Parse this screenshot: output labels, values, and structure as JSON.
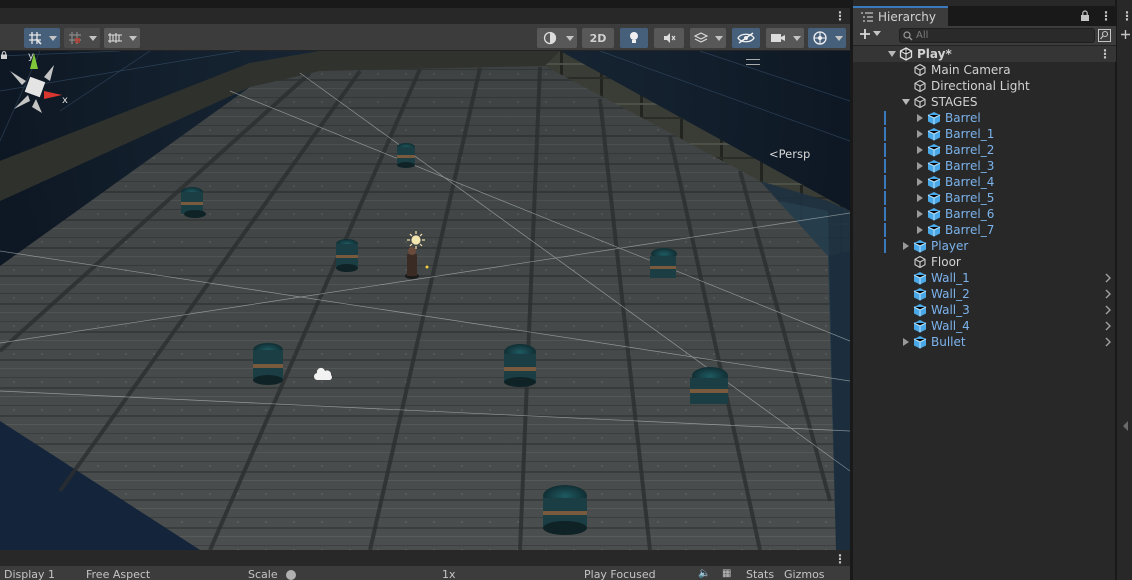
{
  "scene": {
    "toolbar": {
      "button_2d": "2D"
    },
    "viewport": {
      "persp_label": "<Persp",
      "gizmo_axes": {
        "y": "y",
        "x": "x"
      }
    },
    "game_bar": {
      "display": "Display 1",
      "aspect": "Free Aspect",
      "scale_label": "Scale",
      "scale_value": "1x",
      "play_mode": "Play Focused",
      "stats": "Stats",
      "gizmos": "Gizmos"
    }
  },
  "hierarchy": {
    "tab_label": "Hierarchy",
    "search_placeholder": "All",
    "scene_name": "Play*",
    "items": [
      {
        "label": "Main Camera"
      },
      {
        "label": "Directional Light"
      },
      {
        "label": "STAGES"
      },
      {
        "label": "Barrel"
      },
      {
        "label": "Barrel_1"
      },
      {
        "label": "Barrel_2"
      },
      {
        "label": "Barrel_3"
      },
      {
        "label": "Barrel_4"
      },
      {
        "label": "Barrel_5"
      },
      {
        "label": "Barrel_6"
      },
      {
        "label": "Barrel_7"
      },
      {
        "label": "Player"
      },
      {
        "label": "Floor"
      },
      {
        "label": "Wall_1"
      },
      {
        "label": "Wall_2"
      },
      {
        "label": "Wall_3"
      },
      {
        "label": "Wall_4"
      },
      {
        "label": "Bullet"
      }
    ]
  },
  "colors": {
    "accent": "#3a79bb",
    "prefab_text": "#7cb3ec",
    "panel_bg": "#282828",
    "toolbar_bg": "#3c3c3c"
  }
}
